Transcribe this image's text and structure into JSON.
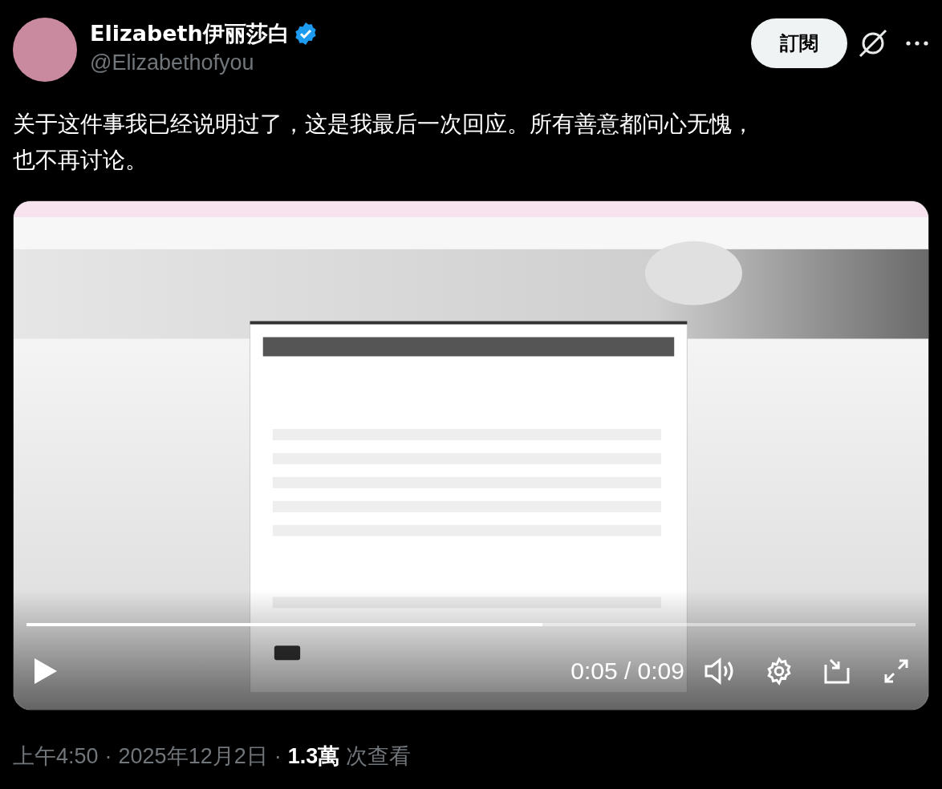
{
  "author": {
    "name": "Elizabeth伊丽莎白",
    "handle": "@Elizabethofyou",
    "verified": true
  },
  "subscribe_button": "訂閱",
  "text_lines": [
    "关于这件事我已经说明过了，这是我最后一次回应。所有善意都问心无愧，",
    "也不再讨论。"
  ],
  "video": {
    "kind": "picture",
    "progress": {
      "level": 0.58
    },
    "time": "0:05 / 0:09"
  },
  "meta": {
    "time": "上午4:50",
    "separator_1": "·",
    "date": "2025年12月2日",
    "separator_2": "·",
    "views": "1.3萬",
    "views_label": "次查看"
  }
}
